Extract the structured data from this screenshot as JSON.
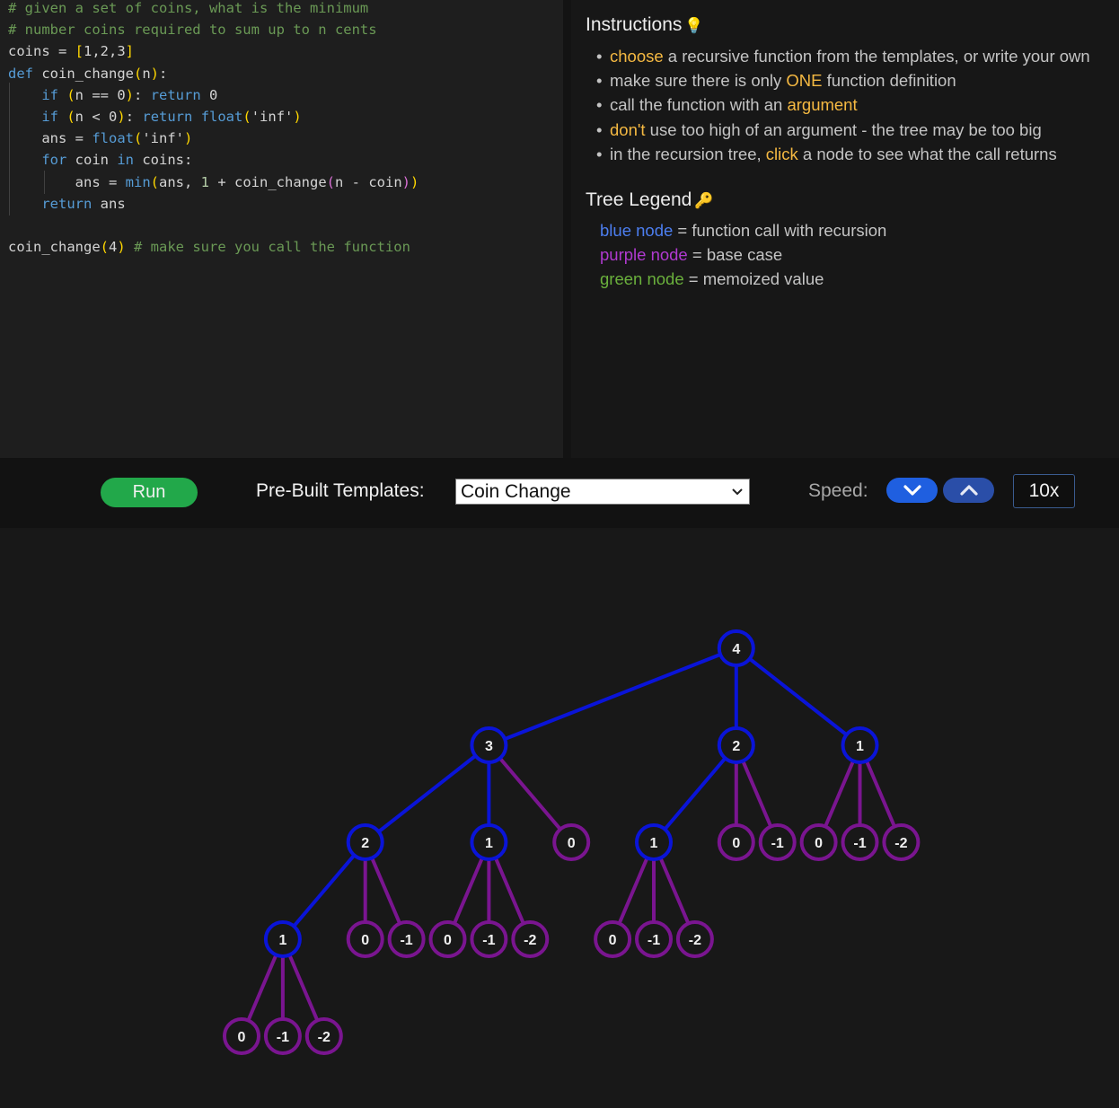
{
  "editor": {
    "lines": [
      [
        {
          "t": "# given a set of coins, what is the minimum",
          "c": "c-comment"
        }
      ],
      [
        {
          "t": "# number coins required to sum up to n cents",
          "c": "c-comment"
        }
      ],
      [
        {
          "t": "coins = ",
          "c": "c-plain"
        },
        {
          "t": "[",
          "c": "c-bracket"
        },
        {
          "t": "1,2,3",
          "c": "c-plain"
        },
        {
          "t": "]",
          "c": "c-bracket"
        }
      ],
      [
        {
          "t": "def ",
          "c": "c-kw"
        },
        {
          "t": "coin_change",
          "c": "c-plain"
        },
        {
          "t": "(",
          "c": "c-bracket"
        },
        {
          "t": "n",
          "c": "c-plain"
        },
        {
          "t": ")",
          "c": "c-bracket"
        },
        {
          "t": ":",
          "c": "c-plain"
        }
      ],
      [
        {
          "t": "    "
        },
        {
          "t": "if ",
          "c": "c-ctrl"
        },
        {
          "t": "(",
          "c": "c-bracket"
        },
        {
          "t": "n == 0",
          "c": "c-plain"
        },
        {
          "t": ")",
          "c": "c-bracket"
        },
        {
          "t": ": ",
          "c": "c-plain"
        },
        {
          "t": "return ",
          "c": "c-ctrl"
        },
        {
          "t": "0",
          "c": "c-plain"
        }
      ],
      [
        {
          "t": "    "
        },
        {
          "t": "if ",
          "c": "c-ctrl"
        },
        {
          "t": "(",
          "c": "c-bracket"
        },
        {
          "t": "n < 0",
          "c": "c-plain"
        },
        {
          "t": ")",
          "c": "c-bracket"
        },
        {
          "t": ": ",
          "c": "c-plain"
        },
        {
          "t": "return ",
          "c": "c-ctrl"
        },
        {
          "t": "float",
          "c": "c-kw"
        },
        {
          "t": "(",
          "c": "c-bracket"
        },
        {
          "t": "'inf'",
          "c": "c-plain"
        },
        {
          "t": ")",
          "c": "c-bracket"
        }
      ],
      [
        {
          "t": "    "
        },
        {
          "t": "ans = ",
          "c": "c-plain"
        },
        {
          "t": "float",
          "c": "c-kw"
        },
        {
          "t": "(",
          "c": "c-bracket"
        },
        {
          "t": "'inf'",
          "c": "c-plain"
        },
        {
          "t": ")",
          "c": "c-bracket"
        }
      ],
      [
        {
          "t": "    "
        },
        {
          "t": "for ",
          "c": "c-ctrl"
        },
        {
          "t": "coin ",
          "c": "c-plain"
        },
        {
          "t": "in ",
          "c": "c-ctrl"
        },
        {
          "t": "coins:",
          "c": "c-plain"
        }
      ],
      [
        {
          "t": "        "
        },
        {
          "t": "ans = ",
          "c": "c-plain"
        },
        {
          "t": "min",
          "c": "c-kw"
        },
        {
          "t": "(",
          "c": "c-bracket"
        },
        {
          "t": "ans, ",
          "c": "c-plain"
        },
        {
          "t": "1",
          "c": "c-num"
        },
        {
          "t": " + coin_change",
          "c": "c-plain"
        },
        {
          "t": "(",
          "c": "c-bracket2"
        },
        {
          "t": "n - coin",
          "c": "c-plain"
        },
        {
          "t": ")",
          "c": "c-bracket2"
        },
        {
          "t": ")",
          "c": "c-bracket"
        }
      ],
      [
        {
          "t": "    "
        },
        {
          "t": "return ",
          "c": "c-ctrl"
        },
        {
          "t": "ans",
          "c": "c-plain"
        }
      ],
      [],
      [
        {
          "t": "coin_change",
          "c": "c-plain"
        },
        {
          "t": "(",
          "c": "c-bracket"
        },
        {
          "t": "4",
          "c": "c-plain"
        },
        {
          "t": ")",
          "c": "c-bracket"
        },
        {
          "t": " # make sure you call the function",
          "c": "c-comment"
        }
      ]
    ]
  },
  "instructions": {
    "title": "Instructions",
    "title_icon": "lightbulb-icon",
    "title_emoji": "💡",
    "items": [
      [
        {
          "t": "choose",
          "hl": true
        },
        {
          "t": " a recursive function from the templates, or write your own"
        }
      ],
      [
        {
          "t": "make sure there is only "
        },
        {
          "t": "ONE",
          "hl": true
        },
        {
          "t": " function definition"
        }
      ],
      [
        {
          "t": "call the function with an "
        },
        {
          "t": "argument",
          "hl": true
        }
      ],
      [
        {
          "t": "don't",
          "hl": true
        },
        {
          "t": " use too high of an argument - the tree may be too big"
        }
      ],
      [
        {
          "t": "in the recursion tree, "
        },
        {
          "t": "click",
          "hl": true
        },
        {
          "t": " a node to see what the call returns"
        }
      ]
    ]
  },
  "legend": {
    "title": "Tree Legend",
    "title_icon": "key-icon",
    "title_emoji": "🔑",
    "items": [
      {
        "key": "blue node",
        "desc": " = function call with recursion",
        "color": "blue"
      },
      {
        "key": "purple node",
        "desc": " = base case",
        "color": "purple"
      },
      {
        "key": "green node",
        "desc": " = memoized value",
        "color": "green"
      }
    ]
  },
  "controls": {
    "run_label": "Run",
    "templates_label": "Pre-Built Templates:",
    "template_selected": "Coin Change",
    "speed_label": "Speed:",
    "speed_value": "10x"
  },
  "colors": {
    "recursive_node": "#0a14d8",
    "base_node": "#7a1590",
    "memo_node": "#3a9a2a",
    "run_button": "#22a84a",
    "highlight": "#f5b942"
  },
  "tree": {
    "label": "4",
    "type": "recursive",
    "children": [
      {
        "label": "3",
        "type": "recursive",
        "children": [
          {
            "label": "2",
            "type": "recursive",
            "children": [
              {
                "label": "1",
                "type": "recursive",
                "children": [
                  {
                    "label": "0",
                    "type": "base"
                  },
                  {
                    "label": "-1",
                    "type": "base"
                  },
                  {
                    "label": "-2",
                    "type": "base"
                  }
                ]
              },
              {
                "label": "0",
                "type": "base"
              },
              {
                "label": "-1",
                "type": "base"
              }
            ]
          },
          {
            "label": "1",
            "type": "recursive",
            "children": [
              {
                "label": "0",
                "type": "base"
              },
              {
                "label": "-1",
                "type": "base"
              },
              {
                "label": "-2",
                "type": "base"
              }
            ]
          },
          {
            "label": "0",
            "type": "base"
          }
        ]
      },
      {
        "label": "2",
        "type": "recursive",
        "children": [
          {
            "label": "1",
            "type": "recursive",
            "children": [
              {
                "label": "0",
                "type": "base"
              },
              {
                "label": "-1",
                "type": "base"
              },
              {
                "label": "-2",
                "type": "base"
              }
            ]
          },
          {
            "label": "0",
            "type": "base"
          },
          {
            "label": "-1",
            "type": "base"
          }
        ]
      },
      {
        "label": "1",
        "type": "recursive",
        "children": [
          {
            "label": "0",
            "type": "base"
          },
          {
            "label": "-1",
            "type": "base"
          },
          {
            "label": "-2",
            "type": "base"
          }
        ]
      }
    ]
  }
}
